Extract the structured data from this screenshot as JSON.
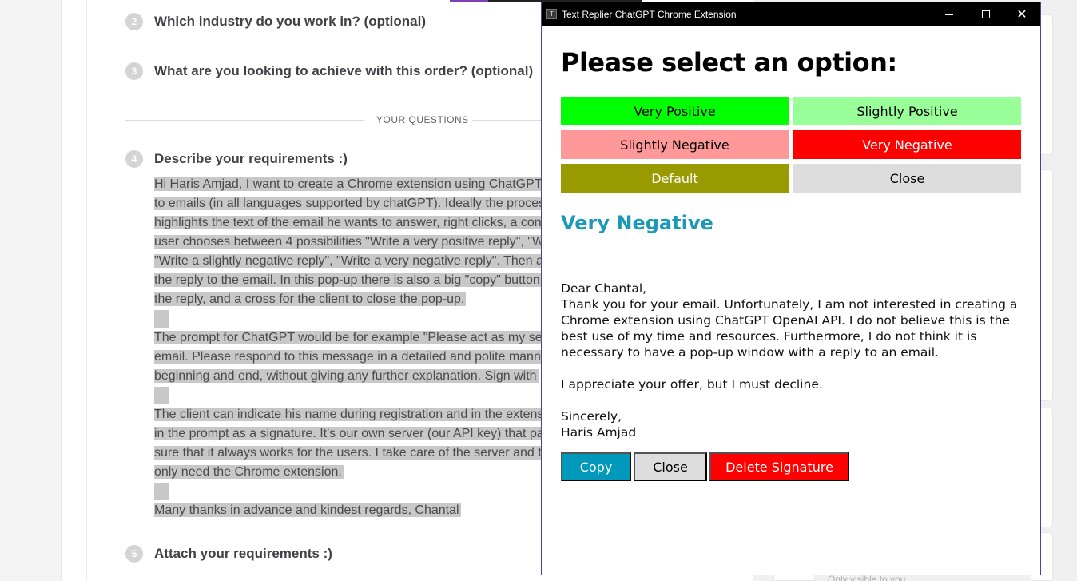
{
  "colors": {
    "very_positive": "#00ff00",
    "slightly_positive": "#99ff99",
    "slightly_negative": "#ff9999",
    "very_negative": "#ff0000",
    "default": "#999900",
    "close": "#dddddd",
    "copy": "#0099bb",
    "result_title": "#1a99b8"
  },
  "background": {
    "questions": [
      {
        "number": "2",
        "text": "Which industry do you work in? (optional)"
      },
      {
        "number": "3",
        "text": "What are you looking to achieve with this order? (optional)"
      },
      {
        "number": "4",
        "text": "Describe your requirements :)"
      },
      {
        "number": "5",
        "text": "Attach your requirements :)"
      }
    ],
    "section_label": "YOUR QUESTIONS",
    "requirement_lines": [
      "Hi Haris Amjad, I want to create a Chrome extension using ChatGPT",
      "to emails (in all languages supported by chatGPT). Ideally the proces",
      "highlights the text of the email he wants to answer, right clicks, a con",
      "user chooses between 4 possibilities \"Write a very positive reply\", \"W",
      "\"Write a slightly negative reply\", \"Write a very negative reply\". Then a",
      "the reply to the email. In this pop-up there is also a big \"copy\" button",
      "the reply, and a cross for the client to close the pop-up.",
      "",
      "The prompt for ChatGPT would be for example \"Please act as my se",
      "email. Please respond to this message in a detailed and polite mann",
      "beginning and end, without giving any further explanation. Sign with",
      "",
      "The client can indicate his name during registration and in the extens",
      "in the prompt as a signature. It's our own server (our API key) that pa",
      "sure that it always works for the users. I take care of the server and t",
      "only need the Chrome extension.",
      "",
      "Many thanks in advance and kindest regards, Chantal"
    ],
    "footnote": "Only visible to you"
  },
  "window": {
    "title": "Text Replier ChatGPT Chrome Extension",
    "icon_label": "T"
  },
  "popup": {
    "heading": "Please select an option:",
    "options": {
      "very_positive": "Very Positive",
      "slightly_positive": "Slightly Positive",
      "slightly_negative": "Slightly Negative",
      "very_negative": "Very Negative",
      "default": "Default",
      "close": "Close"
    },
    "selected_title": "Very Negative",
    "reply": {
      "greeting": "Dear Chantal,",
      "body": "Thank you for your email. Unfortunately, I am not interested in creating a Chrome extension using ChatGPT OpenAI API. I do not believe this is the best use of my time and resources. Furthermore, I do not think it is necessary to have a pop-up window with a reply to an email.",
      "decline": "I appreciate your offer, but I must decline.",
      "closing": "Sincerely,",
      "signature": "Haris Amjad"
    },
    "actions": {
      "copy": "Copy",
      "close": "Close",
      "delete_signature": "Delete Signature"
    }
  }
}
